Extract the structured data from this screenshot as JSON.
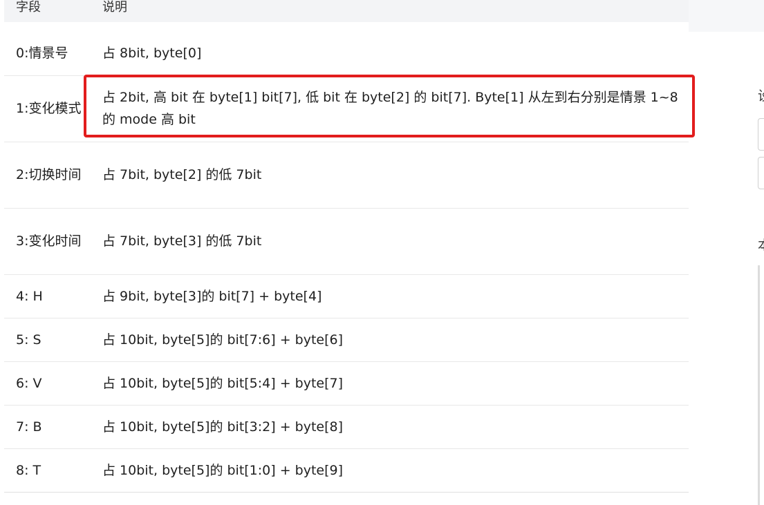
{
  "table": {
    "headers": {
      "field": "字段",
      "description": "说明"
    },
    "rows": [
      {
        "field": "0:情景号",
        "description": "占 8bit, byte[0]"
      },
      {
        "field": "1:变化模式",
        "description": "占 2bit, 高 bit 在 byte[1] bit[7], 低 bit 在 byte[2] 的 bit[7]. Byte[1] 从左到右分别是情景 1~8 的 mode 高 bit",
        "highlighted": true
      },
      {
        "field": "2:切换时间",
        "description": "占 7bit, byte[2] 的低 7bit"
      },
      {
        "field": "3:变化时间",
        "description": "占 7bit, byte[3] 的低 7bit"
      },
      {
        "field": "4: H",
        "description": "占 9bit, byte[3]的 bit[7] + byte[4]"
      },
      {
        "field": "5: S",
        "description": "占 10bit, byte[5]的 bit[7:6] + byte[6]"
      },
      {
        "field": "6: V",
        "description": "占 10bit, byte[5]的 bit[5:4] + byte[7]"
      },
      {
        "field": "7: B",
        "description": "占 10bit, byte[5]的 bit[3:2] + byte[8]"
      },
      {
        "field": "8: T",
        "description": "占 10bit, byte[5]的 bit[1:0] + byte[9]"
      }
    ]
  },
  "side_panel": {
    "char_1": "设",
    "char_2": "本"
  },
  "colors": {
    "highlight_border": "#e21d1d",
    "header_bg": "#f3f4f6",
    "row_divider": "#e8e8e8"
  }
}
